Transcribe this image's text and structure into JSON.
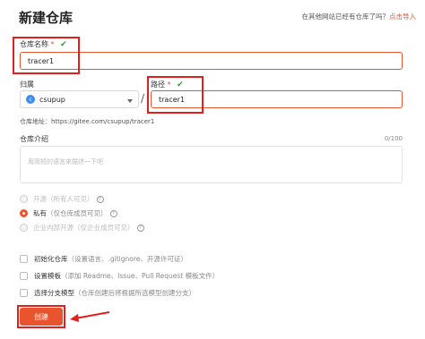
{
  "header": {
    "title": "新建仓库",
    "import_hint": "在其他网站已经有仓库了吗？",
    "import_link": "点击导入"
  },
  "repo_name": {
    "label": "仓库名称",
    "required_mark": "*",
    "value": "tracer1"
  },
  "owner": {
    "label": "归属",
    "avatar_letter": "c",
    "value": "csupup"
  },
  "path": {
    "label": "路径",
    "required_mark": "*",
    "separator": "/",
    "value": "tracer1"
  },
  "repo_address": "仓库地址：https://gitee.com/csupup/tracer1",
  "description": {
    "label": "仓库介绍",
    "counter": "0/100",
    "placeholder": "用简短的语言来描述一下吧"
  },
  "visibility": {
    "options": [
      {
        "label": "开源",
        "hint": "（所有人可见）",
        "info": "?"
      },
      {
        "label": "私有",
        "hint": "（仅仓库成员可见）",
        "info": "?"
      },
      {
        "label": "企业内部开源",
        "hint": "（仅企业成员可见）",
        "info": "?"
      }
    ]
  },
  "options": [
    {
      "label": "初始化仓库",
      "hint": "（设置语言、.gitignore、开源许可证）"
    },
    {
      "label": "设置模板",
      "hint": "（添加 Readme、Issue、Pull Request 模板文件）"
    },
    {
      "label": "选择分支模型",
      "hint": "（仓库创建后将根据所选模型创建分支）"
    }
  ],
  "actions": {
    "create_label": "创建"
  },
  "colors": {
    "accent": "#e8542e",
    "annotation_red": "#e0201c",
    "check_green": "#2e9b3e",
    "avatar_blue": "#3f8cf0"
  },
  "icons": [
    "check-icon",
    "caret-down-icon",
    "info-icon",
    "annotation-arrow-icon"
  ]
}
